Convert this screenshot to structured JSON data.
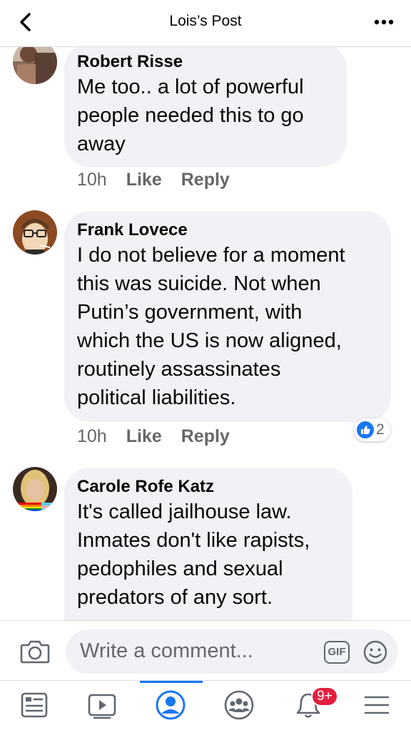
{
  "header": {
    "title": "Lois’s Post",
    "back_icon": "chevron-left-icon",
    "more_icon": "more-horizontal-icon"
  },
  "comments": [
    {
      "author": "Robert Risse",
      "lines": [
        "Me too.. a lot of powerful",
        "people needed this to go",
        "away"
      ],
      "time": "10h",
      "like_label": "Like",
      "reply_label": "Reply"
    },
    {
      "author": "Frank Lovece",
      "lines": [
        "I do not believe for a moment",
        "this was suicide. Not when",
        "Putin’s government, with",
        "which the US is now aligned,",
        "routinely assassinates",
        "political liabilities."
      ],
      "time": "10h",
      "like_label": "Like",
      "reply_label": "Reply",
      "reaction_count": "2"
    },
    {
      "author": "Carole Rofe Katz",
      "lines": [
        "It's called jailhouse law.",
        "Inmates don't like rapists,",
        "pedophiles and sexual",
        "predators of any sort."
      ]
    }
  ],
  "composer": {
    "placeholder": "Write a comment...",
    "gif_label": "GIF"
  },
  "tabbar": {
    "notification_badge": "9+",
    "active_tab": "profile"
  },
  "colors": {
    "accent": "#1877f2",
    "bubble": "#f0f2f5",
    "secondary_text": "#65676b",
    "badge": "#e41e3f"
  }
}
